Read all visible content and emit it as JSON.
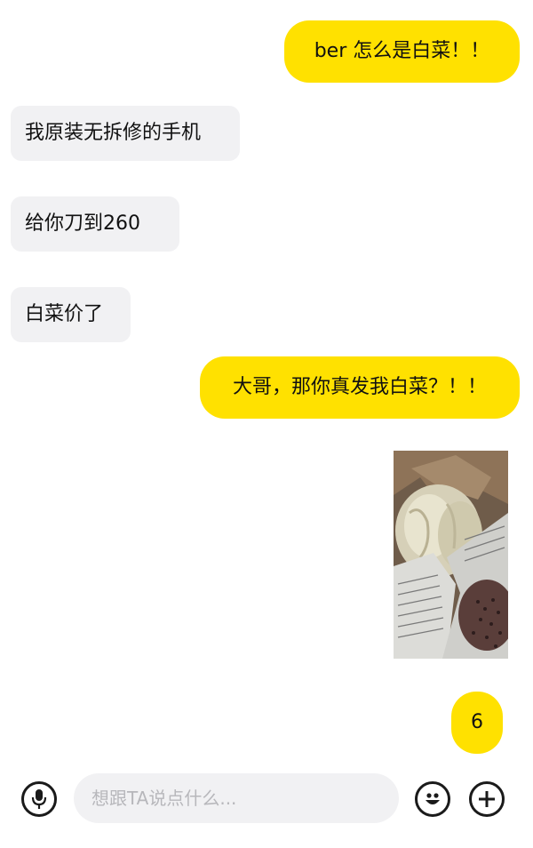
{
  "messages": [
    {
      "side": "outgoing",
      "text": "ber 怎么是白菜！！"
    },
    {
      "side": "incoming",
      "text": "我原装无拆修的手机"
    },
    {
      "side": "incoming",
      "text": "给你刀到260"
    },
    {
      "side": "incoming",
      "text": "白菜价了"
    },
    {
      "side": "outgoing",
      "text": "大哥，那你真发我白菜？！！"
    },
    {
      "side": "outgoing",
      "type": "image"
    },
    {
      "side": "outgoing",
      "text": "6"
    }
  ],
  "composer": {
    "placeholder": "想跟TA说点什么...",
    "value": "",
    "left_icon": "mic-icon",
    "right_icons": [
      "emoji-icon",
      "plus-icon"
    ]
  },
  "colors": {
    "outgoing_bubble": "#ffe100",
    "incoming_bubble": "#f1f1f3",
    "background": "#ffffff",
    "icon": "#1a1a1a"
  }
}
